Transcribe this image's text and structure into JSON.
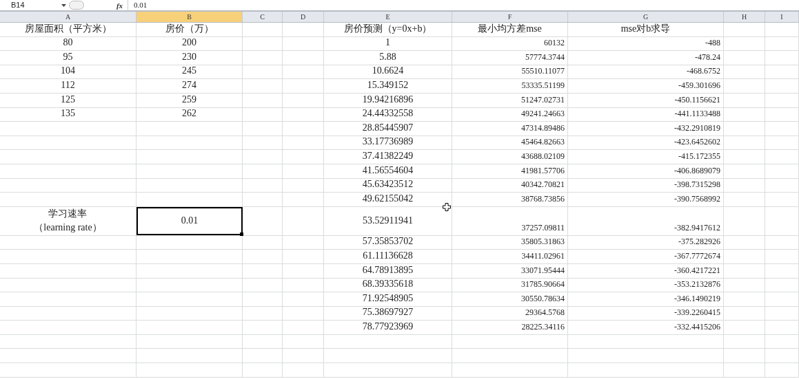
{
  "formula_bar": {
    "name_box": "B14",
    "function_button": "fx",
    "value": "0.01"
  },
  "columns": [
    {
      "label": "A",
      "selected": false
    },
    {
      "label": "B",
      "selected": true
    },
    {
      "label": "C",
      "selected": false
    },
    {
      "label": "D",
      "selected": false
    },
    {
      "label": "E",
      "selected": false
    },
    {
      "label": "F",
      "selected": false
    },
    {
      "label": "G",
      "selected": false
    },
    {
      "label": "H",
      "selected": false
    },
    {
      "label": "I",
      "selected": false
    }
  ],
  "rows": [
    {
      "cells": {
        "A": "房屋面积（平方米）",
        "B": "房价（万）",
        "E": "房价预测（y=0x+b）",
        "F": "最小均方差mse",
        "G": "mse对b求导"
      },
      "kind": "header"
    },
    {
      "cells": {
        "A": "80",
        "B": "200",
        "E": "1",
        "F": "60132",
        "G": "-488"
      }
    },
    {
      "cells": {
        "A": "95",
        "B": "230",
        "E": "5.88",
        "F": "57774.3744",
        "G": "-478.24"
      }
    },
    {
      "cells": {
        "A": "104",
        "B": "245",
        "E": "10.6624",
        "F": "55510.11077",
        "G": "-468.6752"
      }
    },
    {
      "cells": {
        "A": "112",
        "B": "274",
        "E": "15.349152",
        "F": "53335.51199",
        "G": "-459.301696"
      }
    },
    {
      "cells": {
        "A": "125",
        "B": "259",
        "E": "19.94216896",
        "F": "51247.02731",
        "G": "-450.1156621"
      }
    },
    {
      "cells": {
        "A": "135",
        "B": "262",
        "E": "24.44332558",
        "F": "49241.24663",
        "G": "-441.1133488"
      }
    },
    {
      "cells": {
        "E": "28.85445907",
        "F": "47314.89486",
        "G": "-432.2910819"
      }
    },
    {
      "cells": {
        "E": "33.17736989",
        "F": "45464.82663",
        "G": "-423.6452602"
      }
    },
    {
      "cells": {
        "E": "37.41382249",
        "F": "43688.02109",
        "G": "-415.172355"
      }
    },
    {
      "cells": {
        "E": "41.56554604",
        "F": "41981.57706",
        "G": "-406.8689079"
      }
    },
    {
      "cells": {
        "E": "45.63423512",
        "F": "40342.70821",
        "G": "-398.7315298"
      }
    },
    {
      "cells": {
        "E": "49.62155042",
        "F": "38768.73856",
        "G": "-390.7568992"
      }
    },
    {
      "cells": {
        "A": [
          "学习速率",
          "（learning rate）"
        ],
        "B": {
          "text": "0.01",
          "selected": true
        },
        "E": "53.52911941",
        "F": "37257.09811",
        "G": "-382.9417612"
      },
      "kind": "tall"
    },
    {
      "cells": {
        "E": "57.35853702",
        "F": "35805.31863",
        "G": "-375.282926"
      }
    },
    {
      "cells": {
        "E": "61.11136628",
        "F": "34411.02961",
        "G": "-367.7772674"
      }
    },
    {
      "cells": {
        "E": "64.78913895",
        "F": "33071.95444",
        "G": "-360.4217221"
      }
    },
    {
      "cells": {
        "E": "68.39335618",
        "F": "31785.90664",
        "G": "-353.2132876"
      }
    },
    {
      "cells": {
        "E": "71.92548905",
        "F": "30550.78634",
        "G": "-346.1490219"
      }
    },
    {
      "cells": {
        "E": "75.38697927",
        "F": "29364.5768",
        "G": "-339.2260415"
      }
    },
    {
      "cells": {
        "E": "78.77923969",
        "F": "28225.34116",
        "G": "-332.4415206"
      }
    },
    {
      "cells": {}
    },
    {
      "cells": {}
    },
    {
      "cells": {}
    }
  ]
}
